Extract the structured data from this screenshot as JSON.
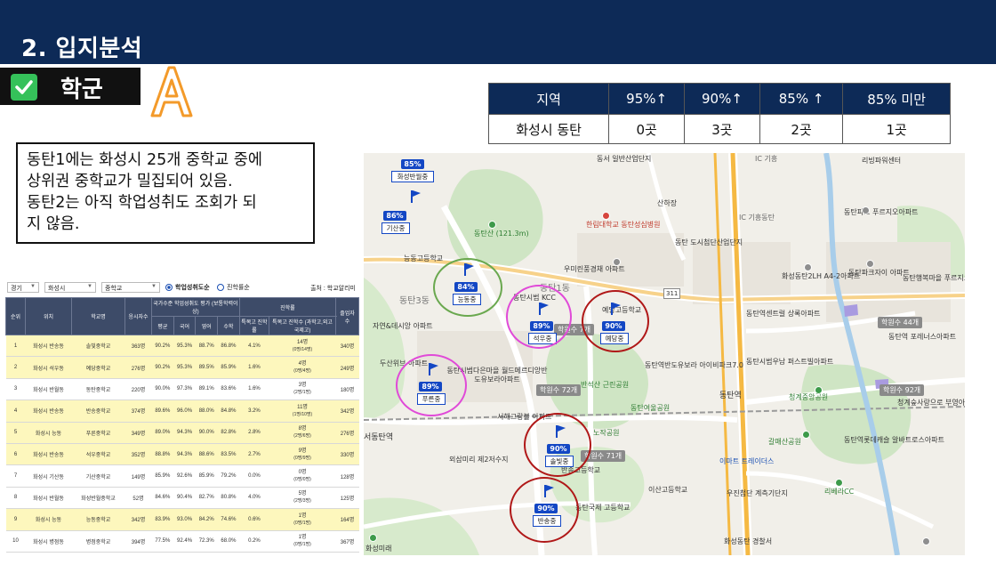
{
  "header": {
    "title": "2. 입지분석"
  },
  "section": {
    "label": "학군",
    "grade": "A"
  },
  "summary_table": {
    "headers": [
      "지역",
      "95%↑",
      "90%↑",
      "85% ↑",
      "85% 미만"
    ],
    "row": [
      "화성시 동탄",
      "0곳",
      "3곳",
      "2곳",
      "1곳"
    ]
  },
  "description": {
    "lines": [
      "동탄1에는 화성시 25개 중학교 중에",
      "상위권 중학교가 밀집되어 있음.",
      "동탄2는 아직 학업성취도 조회가 되",
      "지 않음."
    ]
  },
  "filters": {
    "region": "경기",
    "city": "화성시",
    "level": "중학교",
    "radio_on": "학업성취도순",
    "radio_off": "진학률순",
    "source": "출처 : 학교알리미"
  },
  "rank_table": {
    "headers": [
      "순위",
      "위치",
      "학교명",
      "응시자수",
      "국가수준 학업성취도 평가 (보통학력이상)",
      "평균",
      "국어",
      "영어",
      "수학",
      "특목고 진학률",
      "특목고 진학수 (과학고,외고국제고)",
      "진학률",
      "졸업자 수"
    ],
    "rows": [
      {
        "rank": "1",
        "loc": "화성시 반송동",
        "school": "솔빛중학교",
        "n": "363명",
        "avg": "90.2%",
        "kor": "95.3%",
        "eng": "88.7%",
        "math": "86.8%",
        "rate": "4.1%",
        "cnt1": "14명",
        "cnt2": "(0명/14명)",
        "grad": "340명",
        "hl": true
      },
      {
        "rank": "2",
        "loc": "화성시 석우동",
        "school": "예당중학교",
        "n": "276명",
        "avg": "90.2%",
        "kor": "95.3%",
        "eng": "89.5%",
        "math": "85.9%",
        "rate": "1.6%",
        "cnt1": "4명",
        "cnt2": "(0명/4명)",
        "grad": "249명",
        "hl": true
      },
      {
        "rank": "3",
        "loc": "화성시 반월동",
        "school": "동탄중학교",
        "n": "220명",
        "avg": "90.0%",
        "kor": "97.3%",
        "eng": "89.1%",
        "math": "83.6%",
        "rate": "1.6%",
        "cnt1": "3명",
        "cnt2": "(2명/1명)",
        "grad": "180명",
        "hl": false
      },
      {
        "rank": "4",
        "loc": "화성시 반송동",
        "school": "반송중학교",
        "n": "374명",
        "avg": "89.6%",
        "kor": "96.0%",
        "eng": "88.0%",
        "math": "84.8%",
        "rate": "3.2%",
        "cnt1": "11명",
        "cnt2": "(1명/10명)",
        "grad": "342명",
        "hl": true
      },
      {
        "rank": "5",
        "loc": "화성시 능동",
        "school": "푸른중학교",
        "n": "349명",
        "avg": "89.0%",
        "kor": "94.3%",
        "eng": "90.0%",
        "math": "82.8%",
        "rate": "2.8%",
        "cnt1": "8명",
        "cnt2": "(2명/6명)",
        "grad": "276명",
        "hl": true
      },
      {
        "rank": "6",
        "loc": "화성시 반송동",
        "school": "석우중학교",
        "n": "352명",
        "avg": "88.8%",
        "kor": "94.3%",
        "eng": "88.6%",
        "math": "83.5%",
        "rate": "2.7%",
        "cnt1": "9명",
        "cnt2": "(0명/9명)",
        "grad": "330명",
        "hl": true
      },
      {
        "rank": "7",
        "loc": "화성시 기산동",
        "school": "기산중학교",
        "n": "149명",
        "avg": "85.9%",
        "kor": "92.6%",
        "eng": "85.9%",
        "math": "79.2%",
        "rate": "0.0%",
        "cnt1": "0명",
        "cnt2": "(0명/0명)",
        "grad": "128명",
        "hl": false
      },
      {
        "rank": "8",
        "loc": "화성시 반월동",
        "school": "화성반월중학교",
        "n": "52명",
        "avg": "84.6%",
        "kor": "90.4%",
        "eng": "82.7%",
        "math": "80.8%",
        "rate": "4.0%",
        "cnt1": "5명",
        "cnt2": "(2명/3명)",
        "grad": "125명",
        "hl": false
      },
      {
        "rank": "9",
        "loc": "화성시 능동",
        "school": "능동중학교",
        "n": "342명",
        "avg": "83.9%",
        "kor": "93.0%",
        "eng": "84.2%",
        "math": "74.6%",
        "rate": "0.6%",
        "cnt1": "1명",
        "cnt2": "(0명/1명)",
        "grad": "164명",
        "hl": true
      },
      {
        "rank": "10",
        "loc": "화성시 병점동",
        "school": "병점중학교",
        "n": "394명",
        "avg": "77.5%",
        "kor": "92.4%",
        "eng": "72.3%",
        "math": "68.0%",
        "rate": "0.2%",
        "cnt1": "1명",
        "cnt2": "(0명/1명)",
        "grad": "367명",
        "hl": false
      }
    ]
  },
  "map": {
    "pins": [
      {
        "id": "banwol",
        "pct": "85%",
        "name": "화성반월중"
      },
      {
        "id": "gisan",
        "pct": "86%",
        "name": "기산중"
      },
      {
        "id": "neungdong",
        "pct": "84%",
        "name": "능동중"
      },
      {
        "id": "seokwoo",
        "pct": "89%",
        "name": "석우중"
      },
      {
        "id": "yedang",
        "pct": "90%",
        "name": "예당중"
      },
      {
        "id": "pureun",
        "pct": "89%",
        "name": "푸른중"
      },
      {
        "id": "solbit",
        "pct": "90%",
        "name": "솔빛중"
      },
      {
        "id": "bansong",
        "pct": "90%",
        "name": "반송중"
      }
    ],
    "academies": [
      "학원수 44개",
      "학원수 72개",
      "학원수 92개",
      "학원수 71개",
      "학원수 7개"
    ],
    "labels": {
      "songsan": "동서 일반산업단지",
      "gi": "IC 기흥",
      "riverpower": "리빙파워센터",
      "sanha": "산하장",
      "gh": "IC 기흥동탄",
      "dongtanmt": "동탄산 (121.3m)",
      "hallym": "한림대학교 동탄성심병원",
      "dongtanpark": "동탄파크 푸르지오아파트",
      "dosi": "동탄 도시첨단산업단지",
      "umirin": "우미린풍경채 아파트",
      "sibum": "동탄시범 KCC",
      "ndgo": "능동고등학교",
      "yedanggo": "예당고등학교",
      "a4": "화성동탄2LH A4-2아파트",
      "parkjai": "동탄파크자이 아파트",
      "haengbok": "동탄행복마을 푸르지오와핀트5",
      "dt3": "동탄3동",
      "dt1": "동탄1동",
      "jayeon": "자연&데시앙 아파트",
      "center": "동탄역센트럴 상록아파트",
      "forest": "동탄역 포레너스아파트",
      "dusan": "두산위브 아파트",
      "eun": "동탄시범다은마을 월드메르디앙반도유보라아파트",
      "bando": "동탄역반도유보라 아이비파크7.0",
      "pungmu": "동탄시범우남 퍼스트빌아파트",
      "cheonggye": "청계중앙공원",
      "cheonggye2": "청계숲사랑으로 부영아파트",
      "bansan": "반석산 근린공원",
      "yeoul": "동탄여울공원",
      "dt_station": "동탄역",
      "seohae": "서해그랑블 아파트",
      "nojak": "노작공원",
      "seodong": "서동탄역",
      "oesammi": "외삼미리 제2저수지",
      "galmae": "갈매산공원",
      "lotte": "동탄역롯데캐슬 알바트로스아파트",
      "bansong_hs": "반송고등학교",
      "isan": "이산고등학교",
      "usin": "우진첨단 계측기단지",
      "outlet": "이마트 트레이더스",
      "riverv": "리베라CC",
      "gukje": "동탄국제 고등학교",
      "hwaseongeast": "화성동탄 경찰서",
      "hwasun": "화성미래",
      "misc311": "311"
    }
  }
}
